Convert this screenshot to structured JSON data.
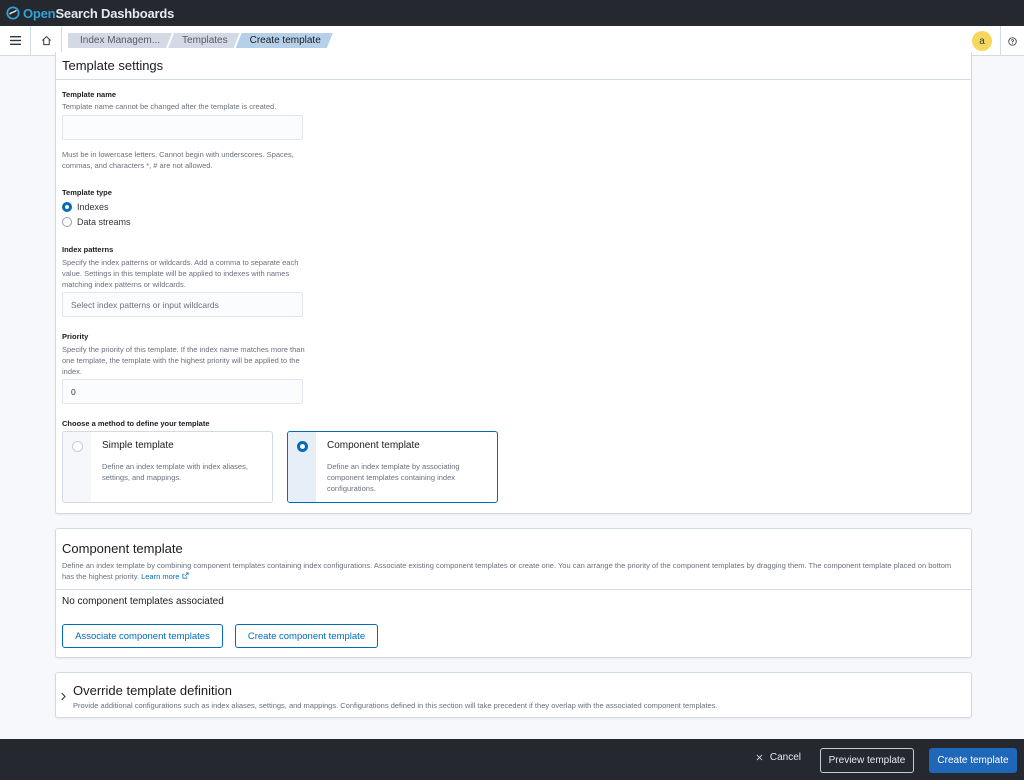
{
  "app": {
    "brand_open": "Open",
    "brand_rest": "Search Dashboards"
  },
  "breadcrumbs": [
    "Index Managem...",
    "Templates",
    "Create template"
  ],
  "user": {
    "avatar_initial": "a"
  },
  "template_settings": {
    "title": "Template settings",
    "name": {
      "label": "Template name",
      "help": "Template name cannot be changed after the template is created.",
      "value": "",
      "rules": "Must be in lowercase letters. Cannot begin with underscores. Spaces, commas, and characters *, # are not allowed."
    },
    "type": {
      "label": "Template type",
      "options": [
        {
          "label": "Indexes",
          "selected": true
        },
        {
          "label": "Data streams",
          "selected": false
        }
      ]
    },
    "index_patterns": {
      "label": "Index patterns",
      "help": "Specify the index patterns or wildcards. Add a comma to separate each value. Settings in this template will be applied to indexes with names matching index patterns or wildcards.",
      "placeholder": "Select index patterns or input wildcards"
    },
    "priority": {
      "label": "Priority",
      "help": "Specify the priority of this template. If the index name matches more than one template, the template with the highest priority will be applied to the index.",
      "value": "0"
    },
    "method": {
      "label": "Choose a method to define your template",
      "options": [
        {
          "title": "Simple template",
          "desc": "Define an index template with index aliases, settings, and mappings.",
          "selected": false
        },
        {
          "title": "Component template",
          "desc": "Define an index template by associating component templates containing index configurations.",
          "selected": true
        }
      ]
    }
  },
  "component_template": {
    "title": "Component template",
    "desc": "Define an index template by combining component templates containing index configurations. Associate existing component templates or create one. You can arrange the priority of the component templates by dragging them. The component template placed on bottom has the highest priority.",
    "learn_more": "Learn more",
    "empty_text": "No component templates associated",
    "associate_label": "Associate component templates",
    "create_label": "Create component template"
  },
  "override": {
    "title": "Override template definition",
    "desc": "Provide additional configurations such as index aliases, settings, and mappings. Configurations defined in this section will take precedent if they overlap with the associated component templates."
  },
  "footer": {
    "cancel_label": "Cancel",
    "preview_label": "Preview template",
    "create_label": "Create template"
  },
  "colors": {
    "accent": "#006bb8",
    "primary_button": "#1f67b8",
    "header_bg": "#25282f"
  }
}
